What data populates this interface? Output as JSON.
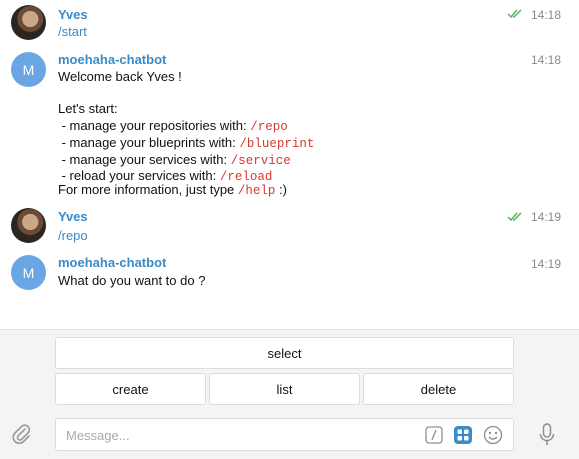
{
  "messages": [
    {
      "sender": "Yves",
      "time": "14:18",
      "text": "/start"
    },
    {
      "sender": "moehaha-chatbot",
      "avatar_letter": "M",
      "time": "14:18",
      "lines": {
        "l1": "Welcome back Yves !",
        "l2": "Let's start:",
        "l3_pre": " - manage your repositories with: ",
        "l3_cmd": "/repo",
        "l4_pre": " - manage your blueprints with: ",
        "l4_cmd": "/blueprint",
        "l5_pre": " - manage your services with: ",
        "l5_cmd": "/service",
        "l6_pre": " - reload your services with: ",
        "l6_cmd": "/reload",
        "l7_pre": "For more information, just type ",
        "l7_cmd": "/help",
        "l7_post": " :)"
      }
    },
    {
      "sender": "Yves",
      "time": "14:19",
      "text": "/repo"
    },
    {
      "sender": "moehaha-chatbot",
      "avatar_letter": "M",
      "time": "14:19",
      "text": "What do you want to do ?"
    }
  ],
  "keyboard": {
    "select": "select",
    "create": "create",
    "list": "list",
    "delete": "delete"
  },
  "input": {
    "placeholder": "Message..."
  },
  "colors": {
    "link": "#3a8bc9",
    "command": "#d43b2f",
    "read_ticks": "#56b65a",
    "avatar_bot": "#6aa6e3"
  }
}
